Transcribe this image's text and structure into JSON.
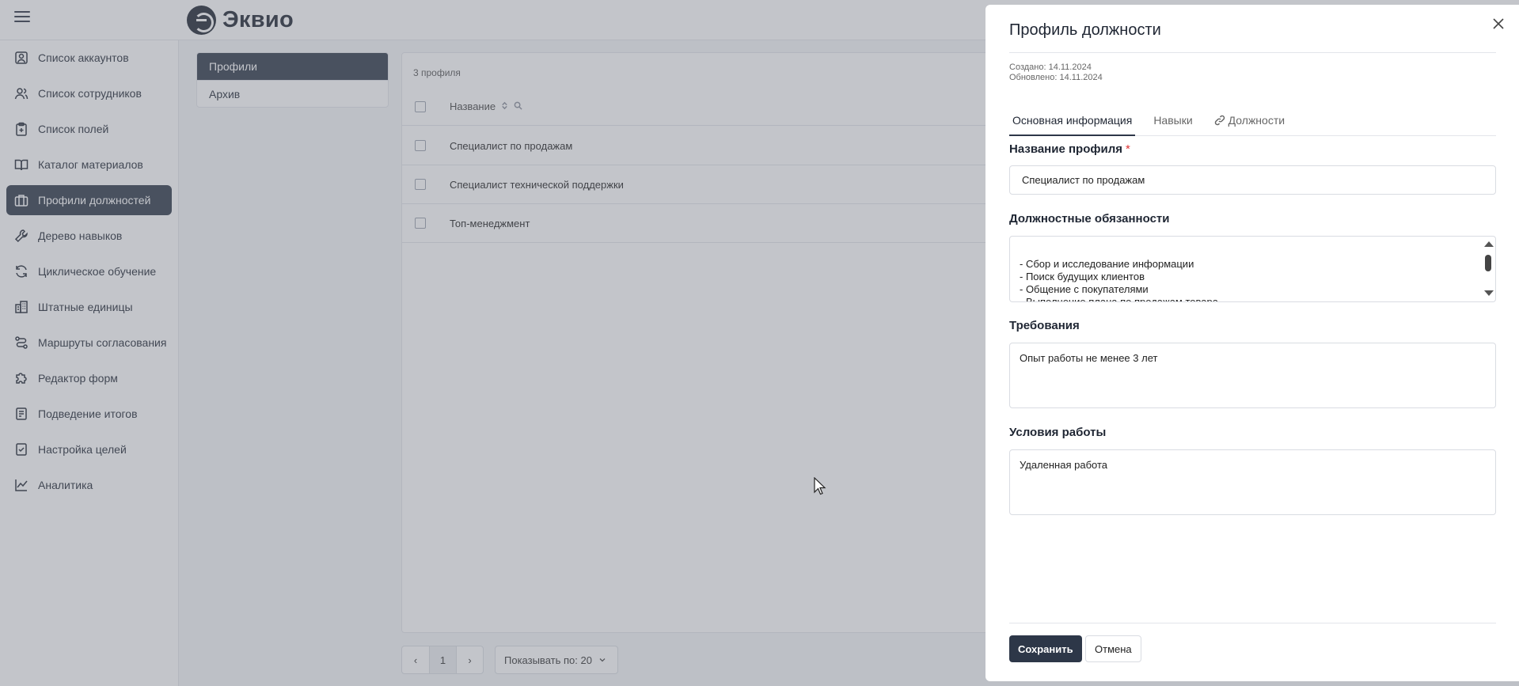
{
  "app": {
    "logo_text": "Эквио"
  },
  "sidebar": {
    "items": [
      {
        "label": "Список аккаунтов",
        "icon": "account-card-icon"
      },
      {
        "label": "Список сотрудников",
        "icon": "users-icon"
      },
      {
        "label": "Список полей",
        "icon": "clipboard-icon"
      },
      {
        "label": "Каталог материалов",
        "icon": "book-icon"
      },
      {
        "label": "Профили должностей",
        "icon": "briefcase-icon",
        "active": true
      },
      {
        "label": "Дерево навыков",
        "icon": "wrench-icon"
      },
      {
        "label": "Циклическое обучение",
        "icon": "refresh-icon"
      },
      {
        "label": "Штатные единицы",
        "icon": "building-icon"
      },
      {
        "label": "Маршруты согласования",
        "icon": "route-icon"
      },
      {
        "label": "Редактор форм",
        "icon": "puzzle-icon"
      },
      {
        "label": "Подведение итогов",
        "icon": "report-icon"
      },
      {
        "label": "Настройка целей",
        "icon": "goal-icon"
      },
      {
        "label": "Аналитика",
        "icon": "chart-icon"
      }
    ]
  },
  "section_tabs": [
    "Профили",
    "Архив"
  ],
  "table": {
    "count": "3 профиля",
    "column": "Название",
    "rows": [
      "Специалист по продажам",
      "Специалист технической поддержки",
      "Топ-менеджмент"
    ]
  },
  "pagination": {
    "page": "1",
    "per_page": "Показывать по: 20"
  },
  "drawer": {
    "title": "Профиль должности",
    "created": "Создано: 14.11.2024",
    "updated": "Обновлено: 14.11.2024",
    "tabs": [
      "Основная информация",
      "Навыки",
      "Должности"
    ],
    "profile_name_label": "Название профиля",
    "required_mark": "*",
    "profile_name_value": "Специалист по продажам",
    "duties_label": "Должностные обязанности",
    "duties_value": "- Сбор и исследование информации\n- Поиск будущих клиентов\n- Общение с покупателями\n- Выполнение плана по продажам товара\n- Заключение договоров и проведение сделок",
    "requirements_label": "Требования",
    "requirements_value": "Опыт работы не менее 3 лет",
    "conditions_label": "Условия работы",
    "conditions_value": "Удаленная работа",
    "save_label": "Сохранить",
    "cancel_label": "Отмена"
  },
  "colors": {
    "accent": "#2d3748",
    "required": "#dd3333",
    "overlay": "#707580"
  }
}
